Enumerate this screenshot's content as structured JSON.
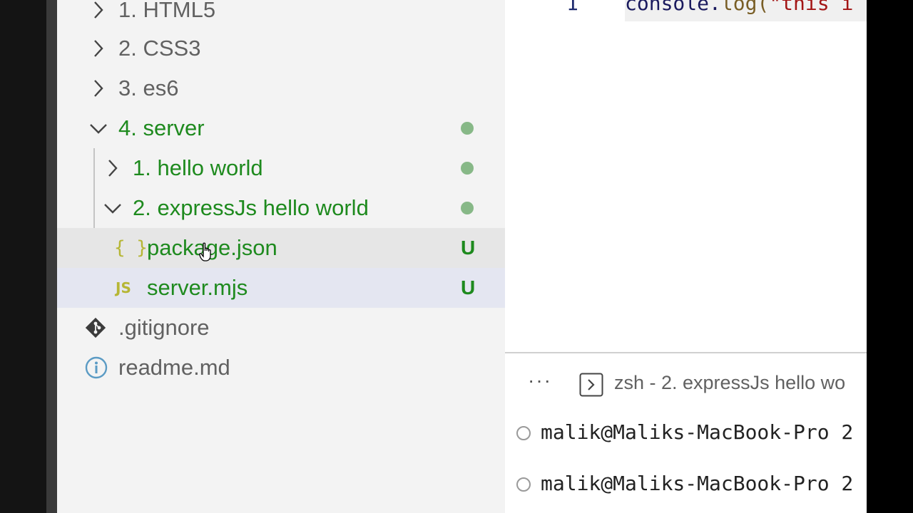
{
  "explorer": {
    "items": [
      {
        "label": "1. HTML5",
        "state": "collapsed",
        "color": "plain"
      },
      {
        "label": "2. CSS3",
        "state": "collapsed",
        "color": "plain"
      },
      {
        "label": "3. es6",
        "state": "collapsed",
        "color": "plain"
      },
      {
        "label": "4. server",
        "state": "expanded",
        "color": "git",
        "decoration": "modified-dot"
      },
      {
        "label": "1. hello world",
        "state": "collapsed",
        "color": "git",
        "decoration": "modified-dot"
      },
      {
        "label": "2. expressJs hello world",
        "state": "expanded",
        "color": "git",
        "decoration": "modified-dot"
      },
      {
        "label": "package.json",
        "icon": "json-icon",
        "icon_glyph": "{ }",
        "badge": "U",
        "color": "git"
      },
      {
        "label": "server.mjs",
        "icon": "js-icon",
        "icon_glyph": "JS",
        "badge": "U",
        "color": "git"
      },
      {
        "label": ".gitignore",
        "icon": "git-icon",
        "color": "plain"
      },
      {
        "label": "readme.md",
        "icon": "info-icon",
        "color": "plain"
      }
    ]
  },
  "editor": {
    "line_number": "1",
    "code_fn": "console",
    "code_dot": ".",
    "code_method": "log",
    "code_paren": "(",
    "code_string": "\"this i"
  },
  "terminal": {
    "more_label": "···",
    "title": "zsh - 2. expressJs hello wo",
    "lines": [
      "malik@Maliks-MacBook-Pro 2",
      "malik@Maliks-MacBook-Pro 2"
    ]
  },
  "colors": {
    "git_added": "#1e8a1e",
    "plain_text": "#616161",
    "modified_dot": "#87b887",
    "file_icon": "#b6b635"
  }
}
